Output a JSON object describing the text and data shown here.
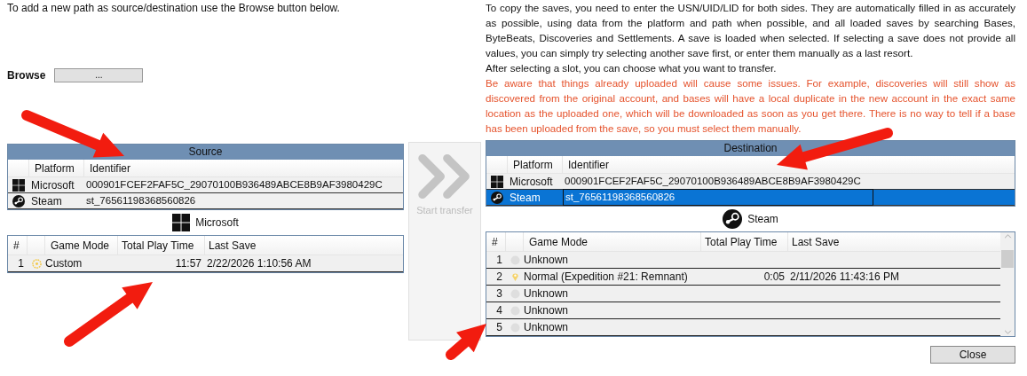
{
  "instructions": "To add a new path as source/destination use the Browse button below.",
  "browse": {
    "label": "Browse",
    "button": "..."
  },
  "source": {
    "title": "Source",
    "columns": [
      "Platform",
      "Identifier"
    ],
    "rows": [
      {
        "kind": "microsoft",
        "platform": "Microsoft",
        "identifier": "000901FCEF2FAF5C_29070100B936489ABCE8B9AF3980429C",
        "selected": false
      },
      {
        "kind": "steam",
        "platform": "Steam",
        "identifier": "st_76561198368560826",
        "selected": false
      }
    ]
  },
  "source_saves": {
    "kind": "microsoft",
    "platform": "Microsoft",
    "columns": [
      "#",
      "Game Mode",
      "Total Play Time",
      "Last Save"
    ],
    "rows": [
      {
        "number": "1",
        "kind": "custom",
        "game_mode": "Custom",
        "play_time": "11:57",
        "last_save": "2/22/2026 1:10:56 AM",
        "selected": false
      }
    ]
  },
  "start_transfer": {
    "label": "Start transfer",
    "disabled": true
  },
  "help": [
    "To copy the saves, you need to enter the USN/UID/LID for both sides. They are automatically filled in as accurately as possible, using data from the platform and path when possible, and all loaded saves by searching Bases, ByteBeats, Discoveries and Settlements. A save is loaded when selected. If selecting a save does not provide all values, you can simply try selecting another save first, or enter them manually as a last resort.",
    "After selecting a slot, you can choose what you want to transfer."
  ],
  "warning": "Be aware that things already uploaded will cause some issues. For example, discoveries will still show as discovered from the original account, and bases will have a local duplicate in the new account in the exact same location as the uploaded one, which will be downloaded as soon as you get there. There is no way to tell if a base has been uploaded from the save, so you must select them manually.",
  "destination": {
    "title": "Destination",
    "columns": [
      "Platform",
      "Identifier"
    ],
    "rows": [
      {
        "kind": "microsoft",
        "platform": "Microsoft",
        "identifier": "000901FCEF2FAF5C_29070100B936489ABCE8B9AF3980429C",
        "selected": false
      },
      {
        "kind": "steam",
        "platform": "Steam",
        "identifier": "st_76561198368560826",
        "selected": true
      }
    ]
  },
  "destination_saves": {
    "kind": "steam",
    "platform": "Steam",
    "columns": [
      "#",
      "Game Mode",
      "Total Play Time",
      "Last Save"
    ],
    "rows": [
      {
        "number": "1",
        "kind": "unknown",
        "game_mode": "Unknown",
        "selected": false
      },
      {
        "number": "2",
        "kind": "normal",
        "game_mode": "Normal (Expedition #21: Remnant)",
        "play_time": "0:05",
        "last_save": "2/11/2026 11:43:16 PM",
        "selected": false
      },
      {
        "number": "3",
        "kind": "unknown",
        "game_mode": "Unknown",
        "selected": false
      },
      {
        "number": "4",
        "kind": "unknown",
        "game_mode": "Unknown",
        "selected": false
      },
      {
        "number": "5",
        "kind": "unknown",
        "game_mode": "Unknown",
        "selected": false
      }
    ]
  },
  "close": {
    "label": "Close"
  }
}
